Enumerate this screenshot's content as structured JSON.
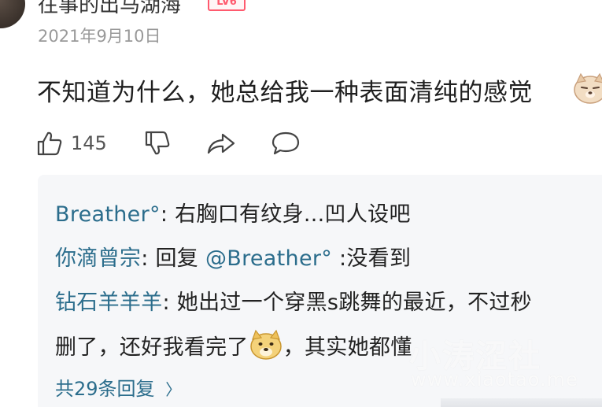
{
  "comment": {
    "username": "往事的出马湖海",
    "badge": "LV6",
    "date": "2021年9月10日",
    "text": "不知道为什么，她总给我一种表面清纯的感觉",
    "likes": "145"
  },
  "replies": [
    {
      "user": "Breather°",
      "sep": ": ",
      "text": "右胸口有纹身...凹人设吧"
    },
    {
      "user": "你滴曾宗",
      "sep": ": ",
      "prefix": "回复 ",
      "mention": "@Breather°",
      "text": " :没看到"
    },
    {
      "user": "钻石羊羊羊",
      "sep": ": ",
      "text": "她出过一个穿黑s跳舞的最近，不过秒",
      "text2a": "删了，还好我看完了",
      "text2b": "，其实她都懂"
    }
  ],
  "more_replies": "共29条回复",
  "more_arrow": "〉",
  "watermark": {
    "cn": "小涛涩社",
    "url": "www.xiaotao.me"
  },
  "icons": [
    "thumbs-up-icon",
    "thumbs-down-icon",
    "share-icon",
    "comment-icon",
    "dog-emoji",
    "doge-emoji"
  ]
}
